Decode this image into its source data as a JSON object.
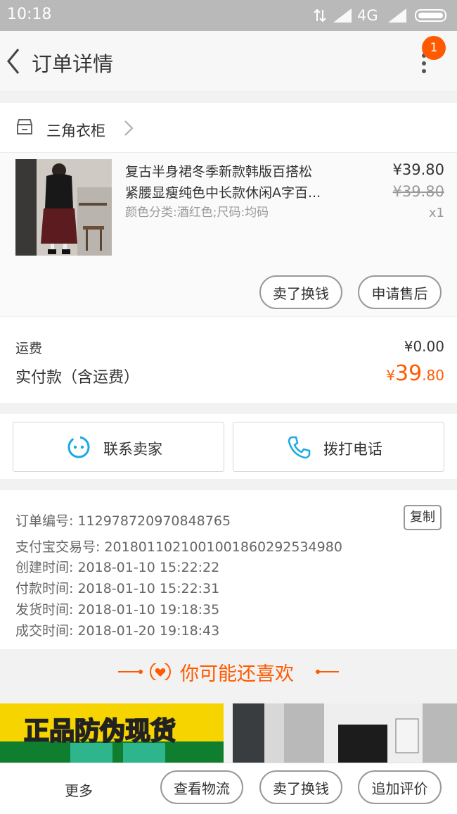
{
  "status_bar": {
    "time": "10:18",
    "network": "4G"
  },
  "header": {
    "title": "订单详情",
    "badge_count": "1"
  },
  "shop": {
    "name": "三角衣柜"
  },
  "product": {
    "title_line1": "复古半身裙冬季新款韩版百搭松",
    "title_line2": "紧腰显瘦纯色中长款休闲A字百...",
    "sku": "颜色分类:酒红色;尺码:均码",
    "price": "¥39.80",
    "original_price": "¥39.80",
    "quantity": "x1",
    "actions": {
      "sell": "卖了换钱",
      "after_sale": "申请售后"
    }
  },
  "fees": {
    "shipping_label": "运费",
    "shipping_value": "¥0.00",
    "paid_label": "实付款（含运费）",
    "paid_currency": "¥",
    "paid_integer": "39",
    "paid_decimal": ".80"
  },
  "contact": {
    "seller": "联系卖家",
    "phone": "拨打电话"
  },
  "order_info": {
    "copy": "复制",
    "lines": [
      "订单编号: 112978720970848765",
      "支付宝交易号: 2018011021001001860292534980",
      "创建时间: 2018-01-10 15:22:22",
      "付款时间: 2018-01-10 15:22:31",
      "发货时间: 2018-01-10 19:18:35",
      "成交时间: 2018-01-20 19:18:43"
    ]
  },
  "recommend": {
    "title": "你可能还喜欢"
  },
  "promo": {
    "banner_text": "正品防伪现货"
  },
  "bottom_bar": {
    "more": "更多",
    "logistics": "查看物流",
    "sell": "卖了换钱",
    "review": "追加评价"
  },
  "colors": {
    "accent": "#ff5a00",
    "bg": "#f2f2f2",
    "contact_icon": "#1ba8e6"
  }
}
